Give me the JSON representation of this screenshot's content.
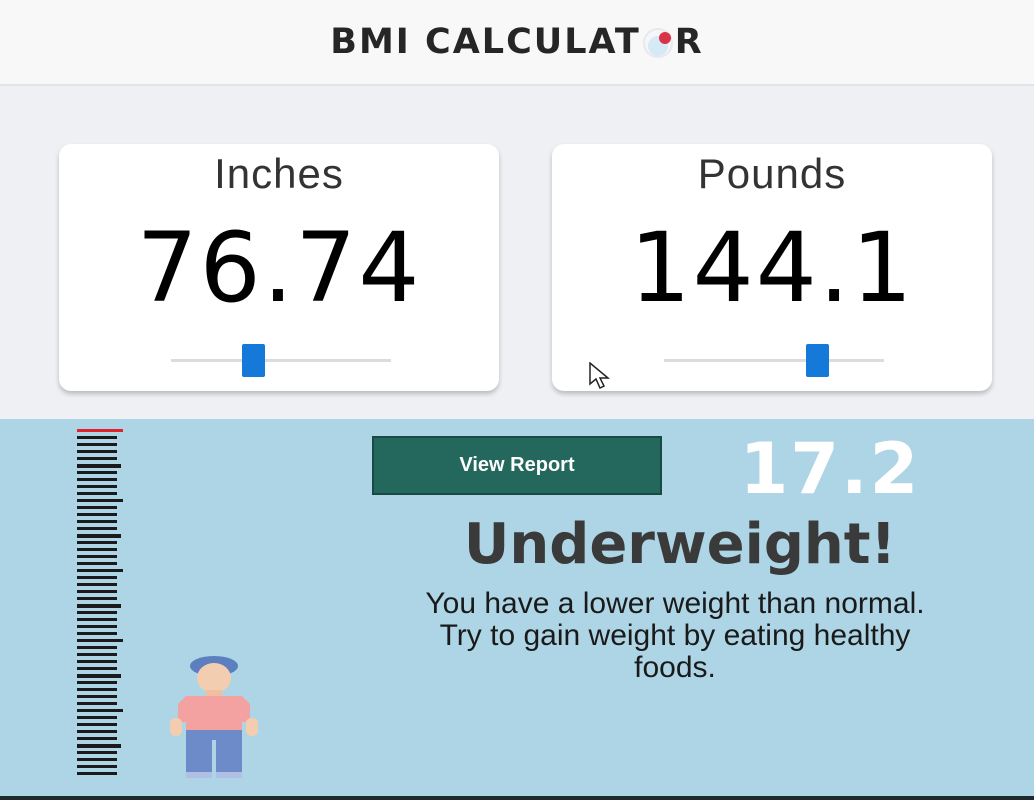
{
  "header": {
    "title_part1": "BMI CALCULAT",
    "title_part2": "R",
    "logo_icon": "stethoscope-heart-icon"
  },
  "height_card": {
    "label": "Inches",
    "value": "76.74",
    "slider_fraction": 0.36
  },
  "weight_card": {
    "label": "Pounds",
    "value": "144.1",
    "slider_fraction": 0.72
  },
  "result": {
    "button_label": "View Report",
    "bmi": "17.2",
    "category": "Underweight!",
    "advice": "You have a lower weight than normal. Try to gain weight by eating healthy foods."
  },
  "colors": {
    "slider_thumb": "#1479d8",
    "report_button": "#23675d",
    "panel_background": "#add5e5",
    "ruler_top_tick": "#e0202a"
  },
  "icons": {
    "cursor": "mouse-pointer-icon",
    "figure": "person-figure-icon"
  }
}
